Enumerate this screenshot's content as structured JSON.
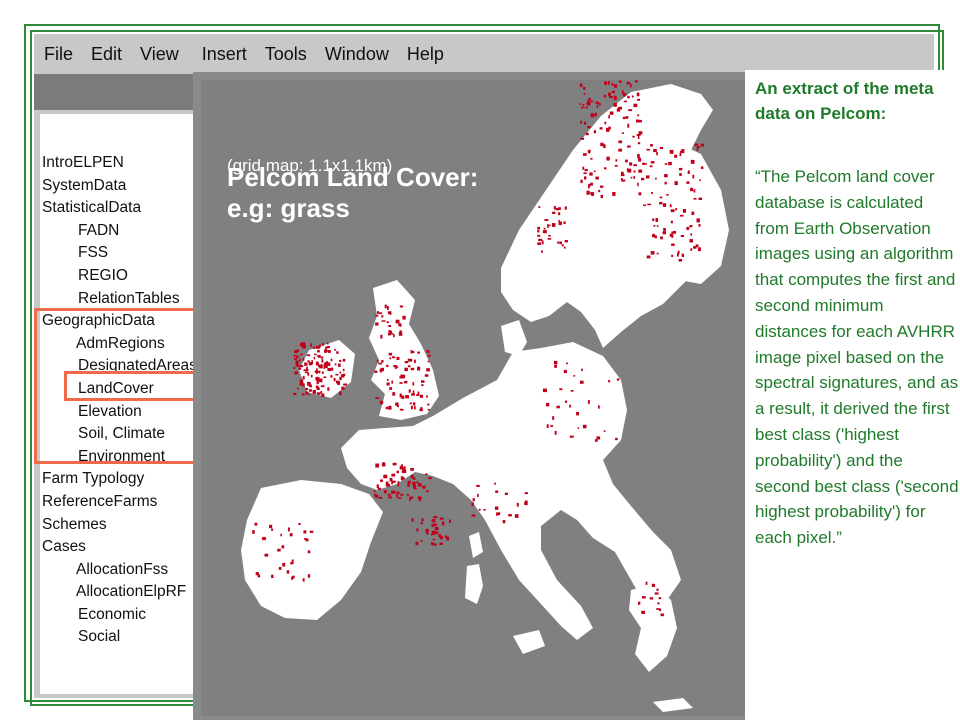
{
  "menubar": {
    "items": [
      "File",
      "Edit",
      "View",
      "Insert",
      "Tools",
      "Window",
      "Help"
    ]
  },
  "sidebar": {
    "tree": [
      {
        "label": "IntroELPEN",
        "level": 0
      },
      {
        "label": "SystemData",
        "level": 0
      },
      {
        "label": "StatisticalData",
        "level": 0
      },
      {
        "label": "FADN",
        "level": 1
      },
      {
        "label": "FSS",
        "level": 1
      },
      {
        "label": "REGIO",
        "level": 1
      },
      {
        "label": "RelationTables",
        "level": 1
      },
      {
        "label": "GeographicData",
        "level": 0
      },
      {
        "label": "AdmRegions",
        "level": 1
      },
      {
        "label": "DesignatedAreas",
        "level": 1
      },
      {
        "label": "LandCover",
        "level": 1
      },
      {
        "label": "Elevation",
        "level": 1
      },
      {
        "label": "Soil, Climate",
        "level": 1
      },
      {
        "label": "Environment",
        "level": 1
      },
      {
        "label": "Farm Typology",
        "level": 0
      },
      {
        "label": "ReferenceFarms",
        "level": 0
      },
      {
        "label": "Schemes",
        "level": 0
      },
      {
        "label": "Cases",
        "level": 0
      },
      {
        "label": "AllocationFss",
        "level": 1
      },
      {
        "label": "AllocationElpRF",
        "level": 1
      },
      {
        "label": "Economic",
        "level": 1
      },
      {
        "label": "Social",
        "level": 1
      }
    ],
    "highlighted_group": "GeographicData",
    "highlighted_item": "LandCover",
    "highlight_color": "#ef6a4c"
  },
  "map": {
    "title_line1": "Pelcom Land Cover:",
    "title_line2": "e.g: grass",
    "subtitle": "(grid map: 1.1x1.1km)",
    "land_color": "#ffffff",
    "grass_color": "#c0001a",
    "sea_color": "#808080"
  },
  "meta": {
    "heading": "An extract of the meta data on Pelcom:",
    "quote": "“The Pelcom land cover database is calculated from Earth Observation images using an algorithm that computes the first and second minimum distances for each AVHRR image pixel based on the spectral signatures, and as a result, it derived the first best class ('highest probability') and the second best class ('second highest probability') for each pixel.”",
    "text_color": "#1f7a2a"
  },
  "frame_color": "#2e8b3a"
}
